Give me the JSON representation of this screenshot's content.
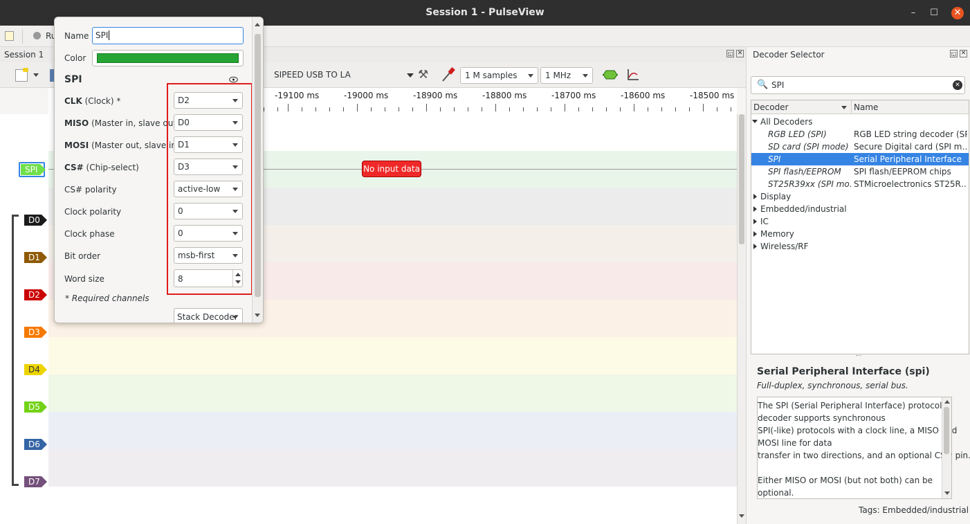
{
  "window": {
    "title": "Session 1 - PulseView",
    "minimize": "–",
    "maximize": "☐",
    "close": "✕"
  },
  "toolbar": {
    "run_label": "Ru"
  },
  "session": {
    "tab_label": "Session 1",
    "device": "SIPEED USB TO LA",
    "samples": "1 M samples",
    "rate": "1 MHz"
  },
  "ruler": {
    "labels": [
      "-19100 ms",
      "-19000 ms",
      "-18900 ms",
      "-18800 ms",
      "-18700 ms",
      "-18600 ms",
      "-18500 ms"
    ]
  },
  "traces": {
    "spi_label": "SPI",
    "no_input": "No input data",
    "channels": [
      {
        "name": "D0",
        "color": "#1b1b1b"
      },
      {
        "name": "D1",
        "color": "#8f5902"
      },
      {
        "name": "D2",
        "color": "#cc0000"
      },
      {
        "name": "D3",
        "color": "#f57900"
      },
      {
        "name": "D4",
        "color": "#edd400"
      },
      {
        "name": "D5",
        "color": "#73d216"
      },
      {
        "name": "D6",
        "color": "#3465a4"
      },
      {
        "name": "D7",
        "color": "#75507b"
      }
    ]
  },
  "popup": {
    "name_label": "Name",
    "name_value": "SPI",
    "color_label": "Color",
    "color_value": "#26a534",
    "decoder_title": "SPI",
    "fields": [
      {
        "bold": "CLK",
        "rest": " (Clock) *",
        "value": "D2"
      },
      {
        "bold": "MISO",
        "rest": " (Master in, slave out)",
        "value": "D0"
      },
      {
        "bold": "MOSI",
        "rest": " (Master out, slave in)",
        "value": "D1"
      },
      {
        "bold": "CS#",
        "rest": " (Chip-select)",
        "value": "D3"
      },
      {
        "bold": "",
        "rest": "CS# polarity",
        "value": "active-low"
      },
      {
        "bold": "",
        "rest": "Clock polarity",
        "value": "0"
      },
      {
        "bold": "",
        "rest": "Clock phase",
        "value": "0"
      },
      {
        "bold": "",
        "rest": "Bit order",
        "value": "msb-first"
      }
    ],
    "word_size_label": "Word size",
    "word_size_value": "8",
    "required_note": "* Required channels",
    "stack_decoder": "Stack Decoder"
  },
  "decoder_selector": {
    "title": "Decoder Selector",
    "search_value": "SPI",
    "col_decoder": "Decoder",
    "col_name": "Name",
    "all_decoders": "All Decoders",
    "decoders": [
      {
        "id": "RGB LED (SPI)",
        "name": "RGB LED string decoder (SPI)",
        "selected": false
      },
      {
        "id": "SD card (SPI mode)",
        "name": "Secure Digital card (SPI m…",
        "selected": false
      },
      {
        "id": "SPI",
        "name": "Serial Peripheral Interface",
        "selected": true
      },
      {
        "id": "SPI flash/EEPROM",
        "name": "SPI flash/EEPROM chips",
        "selected": false
      },
      {
        "id": "ST25R39xx (SPI mo…",
        "name": "STMicroelectronics ST25R…",
        "selected": false
      }
    ],
    "categories": [
      "Display",
      "Embedded/industrial",
      "IC",
      "Memory",
      "Wireless/RF"
    ],
    "desc_title": "Serial Peripheral Interface (spi)",
    "desc_subtitle": "Full-duplex, synchronous, serial bus.",
    "desc_lines": [
      "The SPI (Serial Peripheral Interface) protocol",
      "decoder supports synchronous",
      "SPI(-like) protocols with a clock line, a MISO and",
      "MOSI line for data",
      "transfer in two directions, and an optional CS# pin.",
      "",
      "Either MISO or MOSI (but not both) can be",
      "optional."
    ],
    "tags": "Tags: Embedded/industrial"
  }
}
